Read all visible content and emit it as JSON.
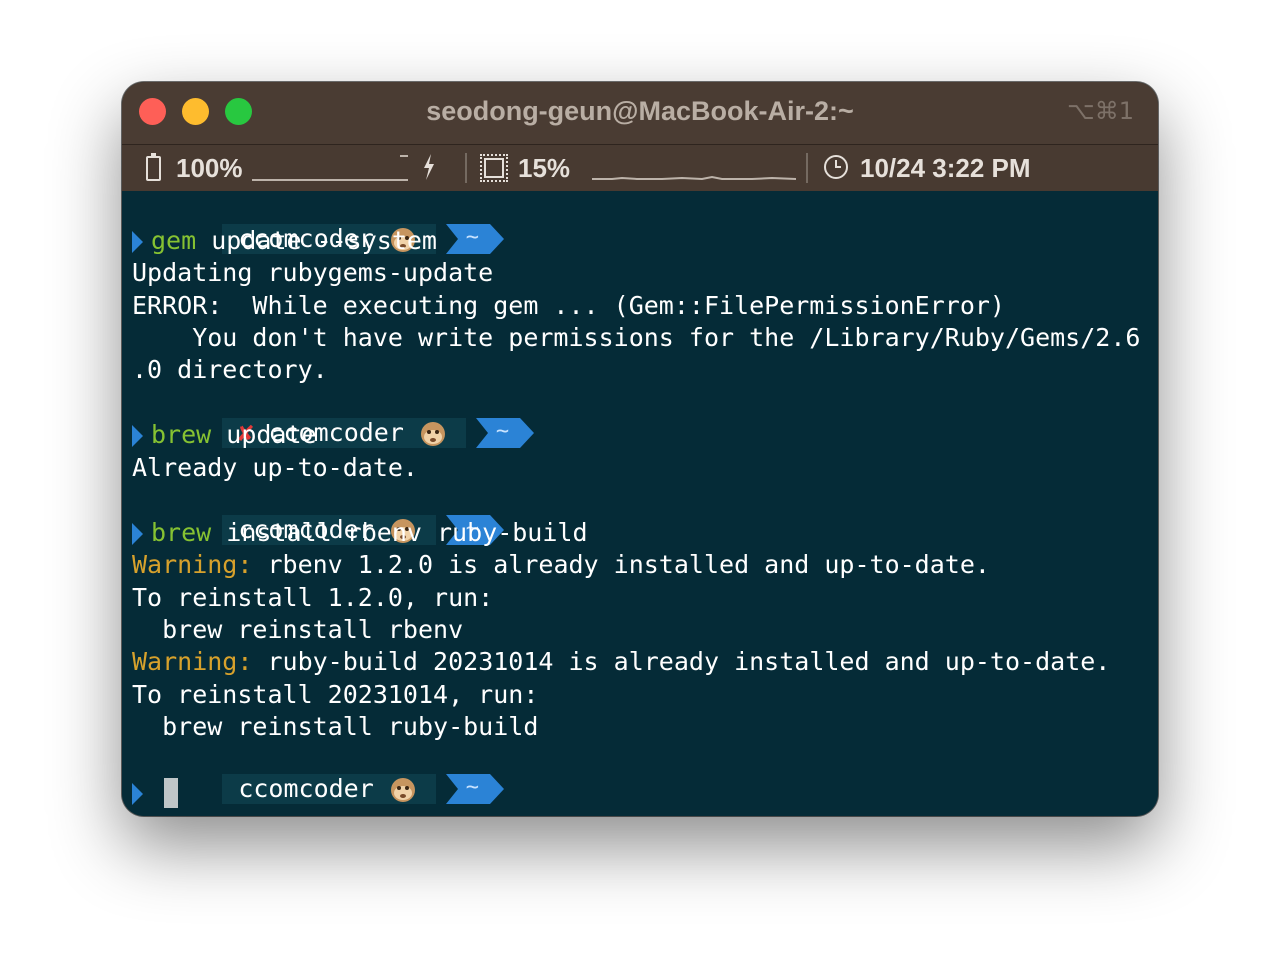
{
  "window": {
    "title": "seodong-geun@MacBook-Air-2:~",
    "shortcut": "⌥⌘1"
  },
  "status_bar": {
    "battery": "100%",
    "battery_level": 1.0,
    "cpu": "15%",
    "datetime": "10/24 3:22 PM"
  },
  "prompt": {
    "user": "ccomcoder",
    "dir": "~",
    "error_mark": "✘"
  },
  "terminal": {
    "cmd1_name": "gem",
    "cmd1_args": " update --system",
    "out1": "Updating rubygems-update",
    "out2": "ERROR:  While executing gem ... (Gem::FilePermissionError)",
    "out3": "    You don't have write permissions for the /Library/Ruby/Gems/2.6",
    "out4": ".0 directory.",
    "cmd2_name": "brew",
    "cmd2_args": " update",
    "out5": "Already up-to-date.",
    "cmd3_name": "brew",
    "cmd3_args": " install rbenv ruby-build",
    "warn_label": "Warning:",
    "warn1_text": " rbenv 1.2.0 is already installed and up-to-date.",
    "out6": "To reinstall 1.2.0, run:",
    "out7": "  brew reinstall rbenv",
    "warn2_text": " ruby-build 20231014 is already installed and up-to-date.",
    "out8": "To reinstall 20231014, run:",
    "out9": "  brew reinstall ruby-build"
  },
  "colors": {
    "terminal_bg": "#052b37",
    "titlebar_bg": "#4a3c33",
    "command_green": "#86c232",
    "warning_yellow": "#d7a12c",
    "prompt_blue": "#2b83d6",
    "close_red": "#fe5f57",
    "minimize_yellow": "#febc2e",
    "zoom_green": "#28c840"
  },
  "icons": [
    "battery-icon",
    "charging-bolt-icon",
    "cpu-icon",
    "clock-icon",
    "monkey-face-icon",
    "prompt-chevron-icon",
    "error-x-icon"
  ]
}
